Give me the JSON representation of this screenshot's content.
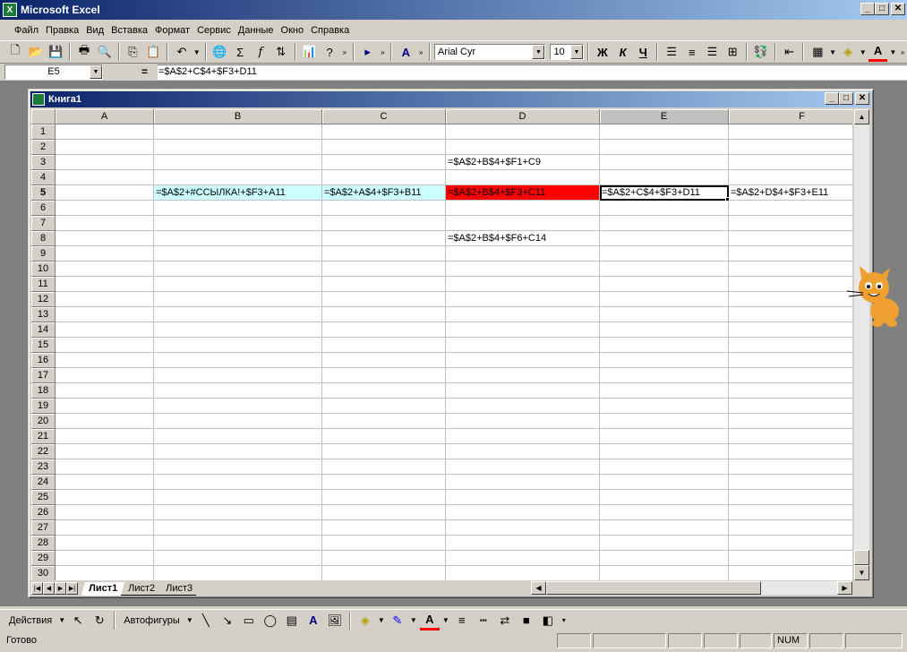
{
  "app": {
    "title": "Microsoft Excel",
    "window_buttons": {
      "minimize": "_",
      "restore": "□",
      "close": "✕"
    }
  },
  "menu": [
    "Файл",
    "Правка",
    "Вид",
    "Вставка",
    "Формат",
    "Сервис",
    "Данные",
    "Окно",
    "Справка"
  ],
  "toolbar": {
    "font_name": "Arial Cyr",
    "font_size": "10",
    "bold": "Ж",
    "italic": "К",
    "underline": "Ч",
    "font_color": "#ff0000"
  },
  "formula_bar": {
    "name_box": "E5",
    "equals": "=",
    "content": "=$A$2+C$4+$F3+D11"
  },
  "workbook": {
    "title": "Книга1",
    "columns": [
      "A",
      "B",
      "C",
      "D",
      "E",
      "F"
    ],
    "rows": [
      "1",
      "2",
      "3",
      "4",
      "5",
      "6",
      "7",
      "8",
      "9",
      "10",
      "11",
      "12",
      "13",
      "14",
      "15",
      "16",
      "17",
      "18",
      "19",
      "20",
      "21",
      "22",
      "23",
      "24",
      "25",
      "26",
      "27",
      "28",
      "29",
      "30"
    ],
    "active_cell": "E5",
    "cells": {
      "D3": "=$A$2+B$4+$F1+C9",
      "B5": "=$A$2+#ССЫЛКА!+$F3+A11",
      "C5": "=$A$2+A$4+$F3+B11",
      "D5": "=$A$2+B$4+$F3+C11",
      "E5": "=$A$2+C$4+$F3+D11",
      "F5": "=$A$2+D$4+$F3+E11",
      "D8": "=$A$2+B$4+$F6+C14"
    },
    "cell_colors": {
      "B5": "#ccffff",
      "C5": "#ccffff",
      "D5": "#ff0000"
    },
    "sheet_tabs": [
      "Лист1",
      "Лист2",
      "Лист3"
    ],
    "active_sheet": "Лист1"
  },
  "draw_toolbar": {
    "actions": "Действия",
    "autoshapes": "Автофигуры"
  },
  "status": {
    "ready": "Готово",
    "num": "NUM"
  }
}
